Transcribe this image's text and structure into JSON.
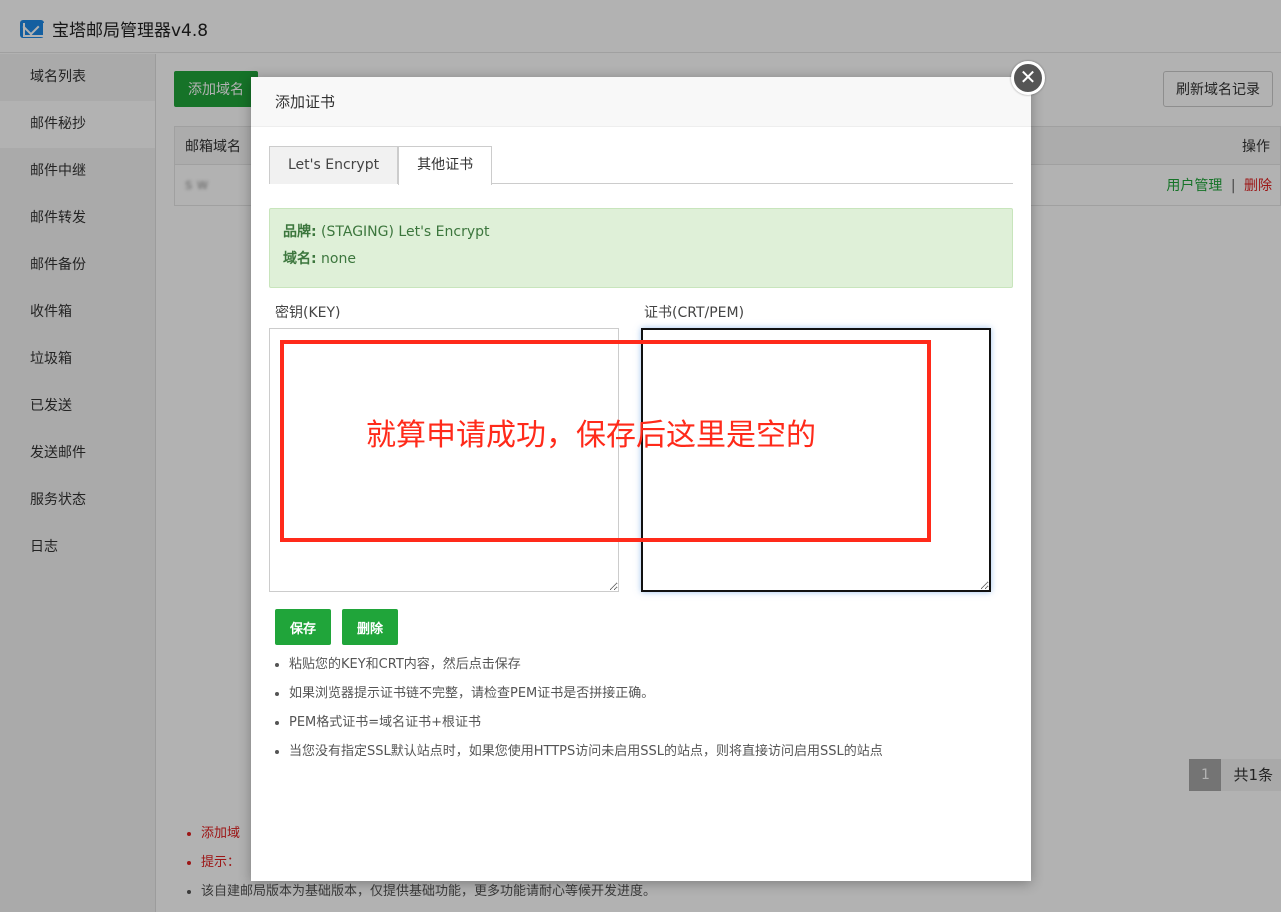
{
  "app": {
    "title": "宝塔邮局管理器v4.8"
  },
  "sidebar": {
    "items": [
      {
        "label": "域名列表"
      },
      {
        "label": "邮件秘抄"
      },
      {
        "label": "邮件中继"
      },
      {
        "label": "邮件转发"
      },
      {
        "label": "邮件备份"
      },
      {
        "label": "收件箱"
      },
      {
        "label": "垃圾箱"
      },
      {
        "label": "已发送"
      },
      {
        "label": "发送邮件"
      },
      {
        "label": "服务状态"
      },
      {
        "label": "日志"
      }
    ]
  },
  "main": {
    "add_domain_label": "添加域名",
    "refresh_label": "刷新域名记录",
    "table": {
      "col_domain": "邮箱域名",
      "col_ops": "操作",
      "row_domain": "s           w",
      "op_user": "用户管理",
      "op_sep": "|",
      "op_delete": "删除"
    },
    "pagination": {
      "page": "1",
      "total": "共1条"
    },
    "tips": [
      {
        "text": "添加域",
        "color": "red"
      },
      {
        "text": "提示：",
        "color": "red"
      },
      {
        "text": "该自建邮局版本为基础版本，仅提供基础功能，更多功能请耐心等候开发进度。",
        "color": "grey"
      }
    ]
  },
  "modal": {
    "title": "添加证书",
    "close_symbol": "✕",
    "tabs": [
      {
        "label": "Let's Encrypt"
      },
      {
        "label": "其他证书"
      }
    ],
    "info": {
      "brand_key": "品牌:",
      "brand_value": " (STAGING) Let's Encrypt",
      "domain_key": "域名:",
      "domain_value": " none"
    },
    "key_label": "密钥(KEY)",
    "cert_label": "证书(CRT/PEM)",
    "annotation": "就算申请成功，保存后这里是空的",
    "save_label": "保存",
    "delete_label": "删除",
    "help": [
      "粘贴您的KEY和CRT内容，然后点击保存",
      "如果浏览器提示证书链不完整，请检查PEM证书是否拼接正确。",
      "PEM格式证书=域名证书+根证书",
      "当您没有指定SSL默认站点时，如果您使用HTTPS访问未启用SSL的站点，则将直接访问启用SSL的站点"
    ]
  }
}
